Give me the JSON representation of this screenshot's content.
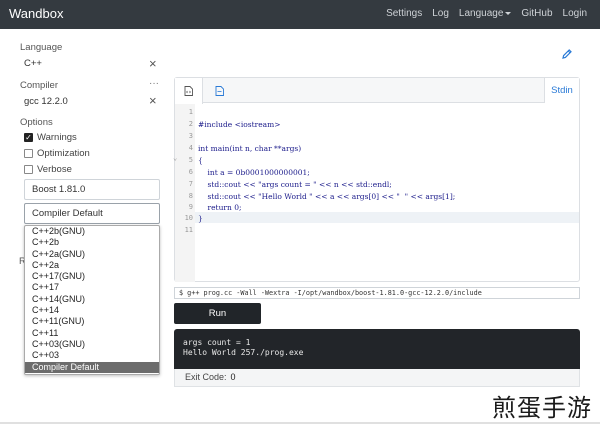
{
  "navbar": {
    "brand": "Wandbox",
    "links": [
      "Settings",
      "Log",
      "Language",
      "GitHub",
      "Login"
    ]
  },
  "sidebar": {
    "language_label": "Language",
    "language_value": "C++",
    "compiler_label": "Compiler",
    "compiler_value": "gcc 12.2.0",
    "options_label": "Options",
    "options": [
      {
        "label": "Warnings",
        "checked": true
      },
      {
        "label": "Optimization",
        "checked": false
      },
      {
        "label": "Verbose",
        "checked": false
      }
    ],
    "boost_select": "Boost 1.81.0",
    "std_select": "Compiler Default",
    "hidden_label_fragment": "R",
    "std_options": [
      "C++2b(GNU)",
      "C++2b",
      "C++2a(GNU)",
      "C++2a",
      "C++17(GNU)",
      "C++17",
      "C++14(GNU)",
      "C++14",
      "C++11(GNU)",
      "C++11",
      "C++03(GNU)",
      "C++03",
      "Compiler Default"
    ],
    "std_selected_index": 12
  },
  "editor": {
    "stdin_tab": "Stdin",
    "line_numbers": [
      "1",
      "2",
      "3",
      "4",
      "5",
      "6",
      "7",
      "8",
      "9",
      "10",
      "11"
    ],
    "code": {
      "l2": "#include <iostream>",
      "l4": "int main(int n, char **args)",
      "l5": "{",
      "l6": "    int a = 0b0001000000001;",
      "l7": "    std::cout << \"args count = \" << n << std::endl;",
      "l8": "    std::cout << \"Hello World \" << a << args[0] << \"  \" << args[1];",
      "l9": "    return 0;",
      "l10": "}"
    }
  },
  "command": "$ g++ prog.cc -Wall -Wextra -I/opt/wandbox/boost-1.81.0-gcc-12.2.0/include",
  "run_label": "Run",
  "output": {
    "lines": [
      "args count = 1",
      "Hello World 257./prog.exe"
    ],
    "exit_label": "Exit Code:",
    "exit_value": "0"
  },
  "watermark": "煎蛋手游",
  "colors": {
    "navbar_bg": "#343a40",
    "output_bg": "#222529",
    "accent": "#2a7ad6"
  }
}
